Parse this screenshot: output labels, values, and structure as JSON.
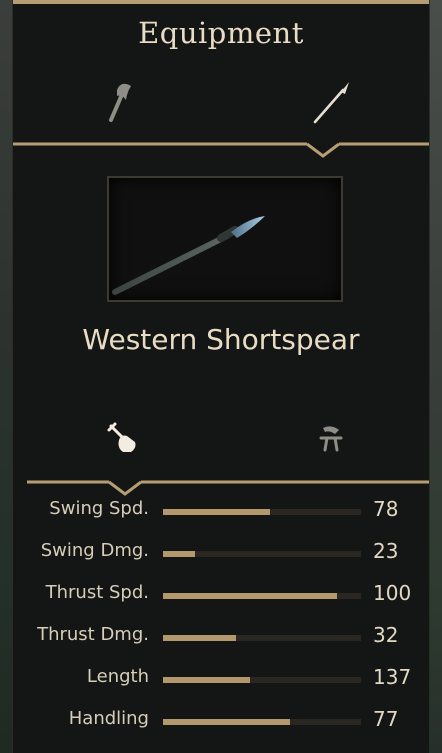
{
  "panel": {
    "title": "Equipment",
    "accent_color": "#b69d73",
    "text_color": "#e8dcc4"
  },
  "weapon_tabs": [
    {
      "name": "axe",
      "icon": "axe-icon",
      "selected": false
    },
    {
      "name": "spear",
      "icon": "spear-icon",
      "selected": true
    }
  ],
  "item": {
    "name": "Western Shortspear",
    "preview": "shortspear"
  },
  "stat_tabs": [
    {
      "name": "melee",
      "icon": "hand-sword-icon",
      "selected": true
    },
    {
      "name": "mounted",
      "icon": "mounted-icon",
      "selected": false
    }
  ],
  "stats": [
    {
      "label": "Swing Spd.",
      "value": "78",
      "fill": 0.54
    },
    {
      "label": "Swing Dmg.",
      "value": "23",
      "fill": 0.16
    },
    {
      "label": "Thrust Spd.",
      "value": "100",
      "fill": 0.88
    },
    {
      "label": "Thrust Dmg.",
      "value": "32",
      "fill": 0.37
    },
    {
      "label": "Length",
      "value": "137",
      "fill": 0.44
    },
    {
      "label": "Handling",
      "value": "77",
      "fill": 0.64
    }
  ]
}
